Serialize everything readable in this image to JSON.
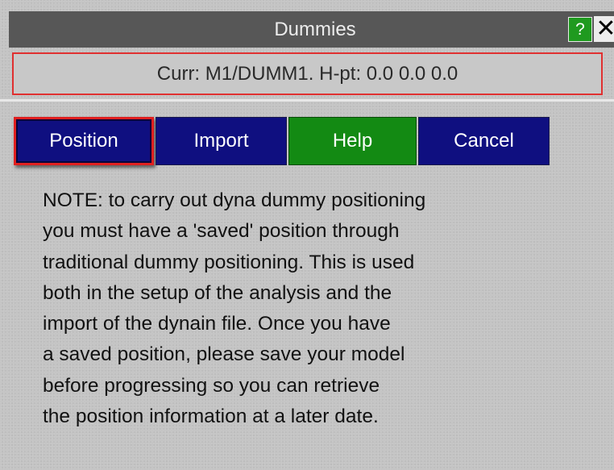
{
  "window": {
    "title": "Dummies",
    "help_icon": "?",
    "close_icon": "✕"
  },
  "status": {
    "text": "Curr: M1/DUMM1. H-pt: 0.0  0.0  0.0"
  },
  "buttons": {
    "position": "Position",
    "import": "Import",
    "help": "Help",
    "cancel": "Cancel"
  },
  "note": {
    "lines": [
      "NOTE: to carry out dyna dummy positioning",
      "you must have a 'saved' position through",
      "traditional dummy positioning. This is used",
      "both in the setup of the analysis and the",
      "import of the dynain file. Once you have",
      "a saved position, please save your model",
      "before progressing so you can retrieve",
      "the position information at a later date."
    ]
  },
  "colors": {
    "titlebar": "#575757",
    "panel": "#c4c4c4",
    "button_blue": "#0f0f80",
    "button_green": "#138a13",
    "highlight_red": "#e02020"
  }
}
